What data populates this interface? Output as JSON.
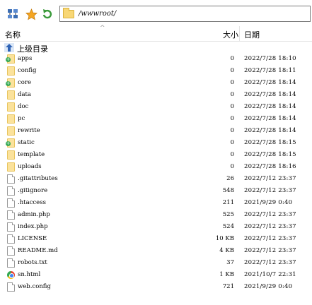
{
  "toolbar": {
    "icons": [
      "network-drive-icon",
      "favorite-star-icon",
      "refresh-icon"
    ],
    "address": "/wwwroot/"
  },
  "header": {
    "name": "名称",
    "size": "大小",
    "date": "日期"
  },
  "parent_dir": {
    "label": "上级目录",
    "icon": "up-directory-icon"
  },
  "files": [
    {
      "name": "apps",
      "size": "0",
      "date": "2022/7/28 18:10",
      "type": "folder",
      "badge": true
    },
    {
      "name": "config",
      "size": "0",
      "date": "2022/7/28 18:11",
      "type": "folder",
      "badge": false
    },
    {
      "name": "core",
      "size": "0",
      "date": "2022/7/28 18:14",
      "type": "folder",
      "badge": true
    },
    {
      "name": "data",
      "size": "0",
      "date": "2022/7/28 18:14",
      "type": "folder",
      "badge": false
    },
    {
      "name": "doc",
      "size": "0",
      "date": "2022/7/28 18:14",
      "type": "folder",
      "badge": false
    },
    {
      "name": "pc",
      "size": "0",
      "date": "2022/7/28 18:14",
      "type": "folder",
      "badge": false
    },
    {
      "name": "rewrite",
      "size": "0",
      "date": "2022/7/28 18:14",
      "type": "folder",
      "badge": false
    },
    {
      "name": "static",
      "size": "0",
      "date": "2022/7/28 18:15",
      "type": "folder",
      "badge": true
    },
    {
      "name": "template",
      "size": "0",
      "date": "2022/7/28 18:15",
      "type": "folder",
      "badge": false
    },
    {
      "name": "uploads",
      "size": "0",
      "date": "2022/7/28 18:16",
      "type": "folder",
      "badge": false
    },
    {
      "name": ".gitattributes",
      "size": "26",
      "date": "2022/7/12 23:37",
      "type": "file"
    },
    {
      "name": ".gitignore",
      "size": "548",
      "date": "2022/7/12 23:37",
      "type": "file"
    },
    {
      "name": ".htaccess",
      "size": "211",
      "date": "2021/9/29 0:40",
      "type": "file"
    },
    {
      "name": "admin.php",
      "size": "525",
      "date": "2022/7/12 23:37",
      "type": "file"
    },
    {
      "name": "index.php",
      "size": "524",
      "date": "2022/7/12 23:37",
      "type": "file"
    },
    {
      "name": "LICENSE",
      "size": "10 KB",
      "date": "2022/7/12 23:37",
      "type": "file"
    },
    {
      "name": "README.md",
      "size": "4 KB",
      "date": "2022/7/12 23:37",
      "type": "file"
    },
    {
      "name": "robots.txt",
      "size": "37",
      "date": "2022/7/12 23:37",
      "type": "file"
    },
    {
      "name": "sn.html",
      "size": "1 KB",
      "date": "2021/10/7 22:31",
      "type": "html"
    },
    {
      "name": "web.config",
      "size": "721",
      "date": "2021/9/29 0:40",
      "type": "file"
    }
  ]
}
